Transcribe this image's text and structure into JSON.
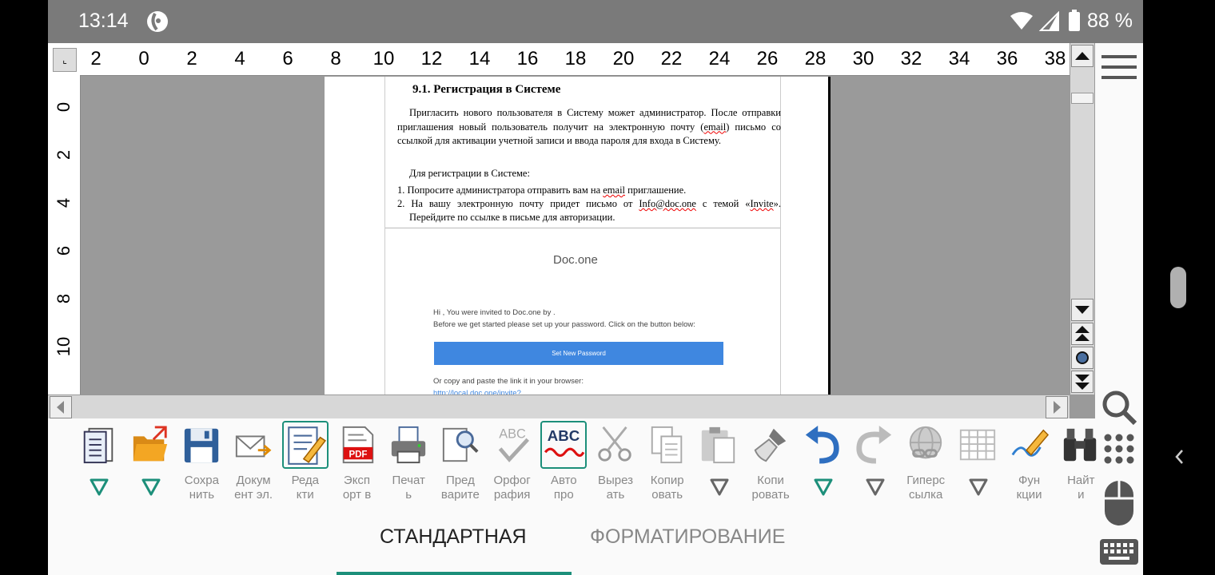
{
  "status_bar": {
    "time": "13:14",
    "battery": "88 %"
  },
  "ruler": {
    "horizontal": [
      "2",
      "0",
      "2",
      "4",
      "6",
      "8",
      "10",
      "12",
      "14",
      "16",
      "18",
      "20",
      "22",
      "24",
      "26",
      "28",
      "30",
      "32",
      "34",
      "36",
      "38"
    ],
    "vertical": [
      "0",
      "2",
      "4",
      "6",
      "8",
      "10"
    ]
  },
  "document": {
    "heading": "9.1.  Регистрация в Системе",
    "para1_before": "Пригласить нового пользователя в Систему может администратор. После отправки приглашения новый пользователь получит на электронную почту (",
    "para1_email": "email",
    "para1_after": ") письмо со ссылкой для активации учетной записи и ввода пароля для входа в Систему.",
    "para2": "Для регистрации в Системе:",
    "list": [
      {
        "before": "1. Попросите администратора отправить вам на ",
        "mark": "email",
        "after": " приглашение."
      },
      {
        "before": "2. На вашу электронную почту придет письмо от ",
        "mark": "Info@doc.one",
        "after": " с темой «",
        "mark2": "Invite",
        "after2": "». Перейдите по ссылке в письме для авторизации."
      }
    ],
    "email_logo": "Doc.one",
    "email_line1": "Hi , You were invited to Doc.one by .",
    "email_line2": "Before we get started please set up your password. Click on the button below:",
    "email_button": "Set New Password",
    "email_line3": "Or copy and paste the link it in your browser:",
    "email_link": "http://local.doc.one/invite?"
  },
  "toolbar": [
    {
      "name": "document-tool",
      "icon": "document-layers-icon",
      "label": ""
    },
    {
      "name": "open-tool",
      "icon": "folder-open-icon",
      "label": ""
    },
    {
      "name": "save-tool",
      "icon": "floppy-disk-icon",
      "label": "Сохра нить"
    },
    {
      "name": "email-tool",
      "icon": "envelope-arrow-icon",
      "label": "Докум ент эл."
    },
    {
      "name": "edit-tool",
      "icon": "edit-pencil-icon",
      "label": "Реда кти"
    },
    {
      "name": "export-pdf-tool",
      "icon": "pdf-icon",
      "label": "Эксп орт в"
    },
    {
      "name": "print-tool",
      "icon": "printer-icon",
      "label": "Печат ь"
    },
    {
      "name": "preview-tool",
      "icon": "magnifier-page-icon",
      "label": "Пред варите"
    },
    {
      "name": "spelling-tool",
      "icon": "abc-check-icon",
      "label": "Орфог рафия"
    },
    {
      "name": "autospell-tool",
      "icon": "abc-wavy-icon",
      "label": "Авто про"
    },
    {
      "name": "cut-tool",
      "icon": "scissors-icon",
      "label": "Вырез ать"
    },
    {
      "name": "copy-tool",
      "icon": "copy-pages-icon",
      "label": "Копир овать"
    },
    {
      "name": "paste-tool",
      "icon": "clipboard-icon",
      "label": ""
    },
    {
      "name": "clone-format-tool",
      "icon": "brush-icon",
      "label": "Копи ровать"
    },
    {
      "name": "undo-tool",
      "icon": "undo-arrow-icon",
      "label": ""
    },
    {
      "name": "redo-tool",
      "icon": "redo-arrow-icon",
      "label": ""
    },
    {
      "name": "hyperlink-tool",
      "icon": "globe-chain-icon",
      "label": "Гиперс сылка"
    },
    {
      "name": "table-tool",
      "icon": "table-grid-icon",
      "label": ""
    },
    {
      "name": "functions-tool",
      "icon": "pen-line-icon",
      "label": "Фун кции"
    },
    {
      "name": "find-tool",
      "icon": "binoculars-icon",
      "label": "Найт и"
    }
  ],
  "tabs": {
    "standard": "СТАНДАРТНАЯ",
    "format": "ФОРМАТИРОВАНИЕ"
  },
  "colors": {
    "accent": "#1c8f7a",
    "status_bar": "#7a7a7a",
    "doc_background": "#9a9a9a",
    "email_button": "#3f87e0"
  }
}
